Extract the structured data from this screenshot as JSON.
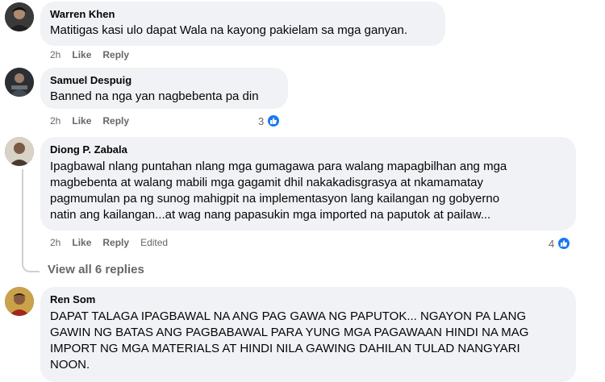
{
  "comments": [
    {
      "author": "Warren Khen",
      "text": "Matitigas kasi ulo dapat Wala na kayong pakielam sa mga ganyan.",
      "time": "2h",
      "like_label": "Like",
      "reply_label": "Reply"
    },
    {
      "author": "Samuel Despuig",
      "text": "Banned na nga yan nagbebenta pa din",
      "time": "2h",
      "like_label": "Like",
      "reply_label": "Reply",
      "reaction_count": "3",
      "reaction_icon": "like-icon"
    },
    {
      "author": "Diong P. Zabala",
      "text": "Ipagbawal nlang puntahan nlang mga gumagawa para walang mapagbilhan ang mga\nmagbebenta at walang mabili mga gagamit dhil nakakadisgrasya at nkamamatay\npagmumulan pa ng sunog mahigpit na implementasyon lang kailangan ng gobyerno\nnatin ang kailangan...at wag nang papasukin mga imported na paputok at pailaw...",
      "time": "2h",
      "like_label": "Like",
      "reply_label": "Reply",
      "edited_label": "Edited",
      "reaction_count": "4",
      "reaction_icon": "like-icon"
    },
    {
      "author": "Ren Som",
      "text": "DAPAT TALAGA IPAGBAWAL NA ANG PAG GAWA NG PAPUTOK... NGAYON PA LANG\nGAWIN NG BATAS ANG PAGBABAWAL PARA YUNG MGA PAGAWAAN HINDI NA MAG\nIMPORT NG MGA MATERIALS AT HINDI NILA GAWING DAHILAN TULAD NANGYARI\nNOON."
    }
  ],
  "view_replies_label": "View all 6 replies",
  "colors": {
    "bubble": "#f0f2f5",
    "meta": "#65676b",
    "like_blue": "#1877f2"
  }
}
